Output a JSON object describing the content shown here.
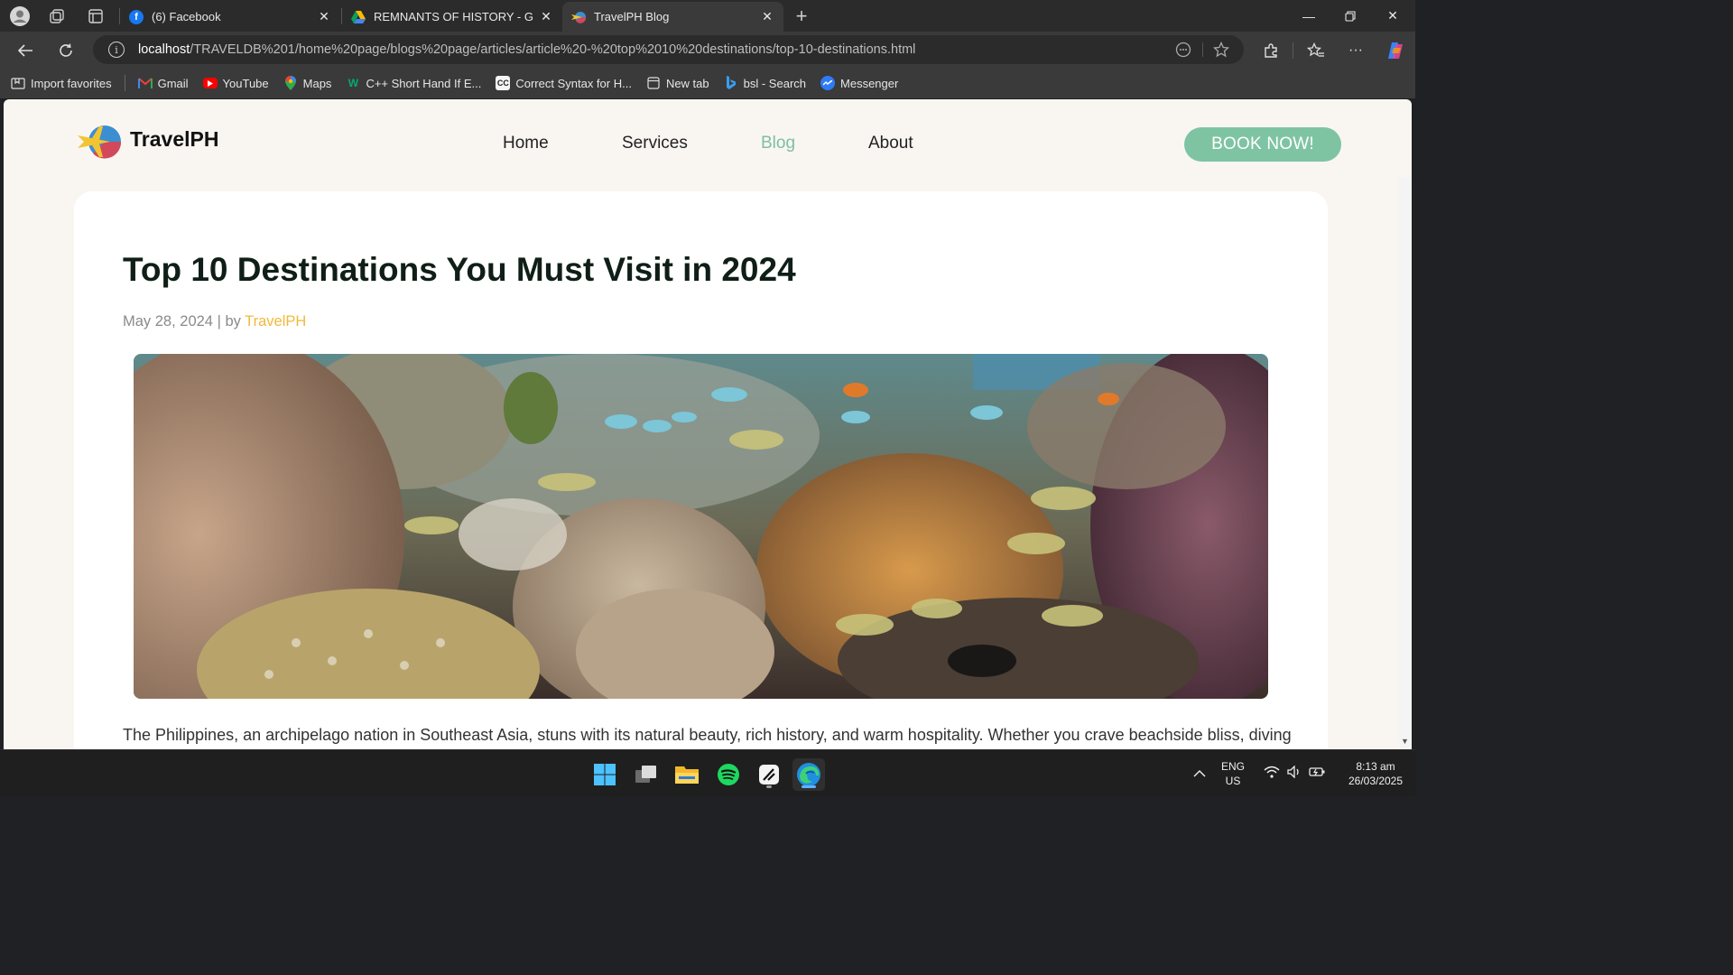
{
  "browser": {
    "tabs": [
      {
        "title": "(6) Facebook",
        "icon": "facebook-icon"
      },
      {
        "title": "REMNANTS OF HISTORY - Google",
        "icon": "google-drive-icon"
      },
      {
        "title": "TravelPH Blog",
        "icon": "travelph-icon"
      }
    ],
    "new_tab_symbol": "+",
    "address": {
      "host": "localhost",
      "path": "/TRAVELDB%201/home%20page/blogs%20page/articles/article%20-%20top%2010%20destinations/top-10-destinations.html"
    },
    "bookmarks": [
      {
        "label": "Import favorites",
        "icon": "import-icon"
      },
      {
        "label": "Gmail",
        "icon": "gmail-icon"
      },
      {
        "label": "YouTube",
        "icon": "youtube-icon"
      },
      {
        "label": "Maps",
        "icon": "maps-icon"
      },
      {
        "label": "C++ Short Hand If E...",
        "icon": "w3schools-icon"
      },
      {
        "label": "Correct Syntax for H...",
        "icon": "cc-icon"
      },
      {
        "label": "New tab",
        "icon": "new-tab-icon"
      },
      {
        "label": "bsl - Search",
        "icon": "bing-icon"
      },
      {
        "label": "Messenger",
        "icon": "messenger-icon"
      }
    ]
  },
  "site": {
    "brand": "TravelPH",
    "nav": [
      {
        "label": "Home"
      },
      {
        "label": "Services"
      },
      {
        "label": "Blog"
      },
      {
        "label": "About"
      }
    ],
    "book_button": "BOOK NOW!",
    "accent": "#7fc4a2",
    "author_color": "#f1b93b"
  },
  "article": {
    "title": "Top 10 Destinations You Must Visit in 2024",
    "date": "May 28, 2024",
    "by": "| by",
    "author": "TravelPH",
    "intro": "The Philippines, an archipelago nation in Southeast Asia, stuns with its natural beauty, rich history, and warm hospitality. Whether you crave beachside bliss, diving"
  },
  "taskbar": {
    "apps": [
      "windows-start-icon",
      "task-view-icon",
      "file-explorer-icon",
      "spotify-icon",
      "app-icon",
      "edge-icon"
    ],
    "lang": "ENG",
    "region": "US",
    "time": "8:13 am",
    "date": "26/03/2025"
  }
}
